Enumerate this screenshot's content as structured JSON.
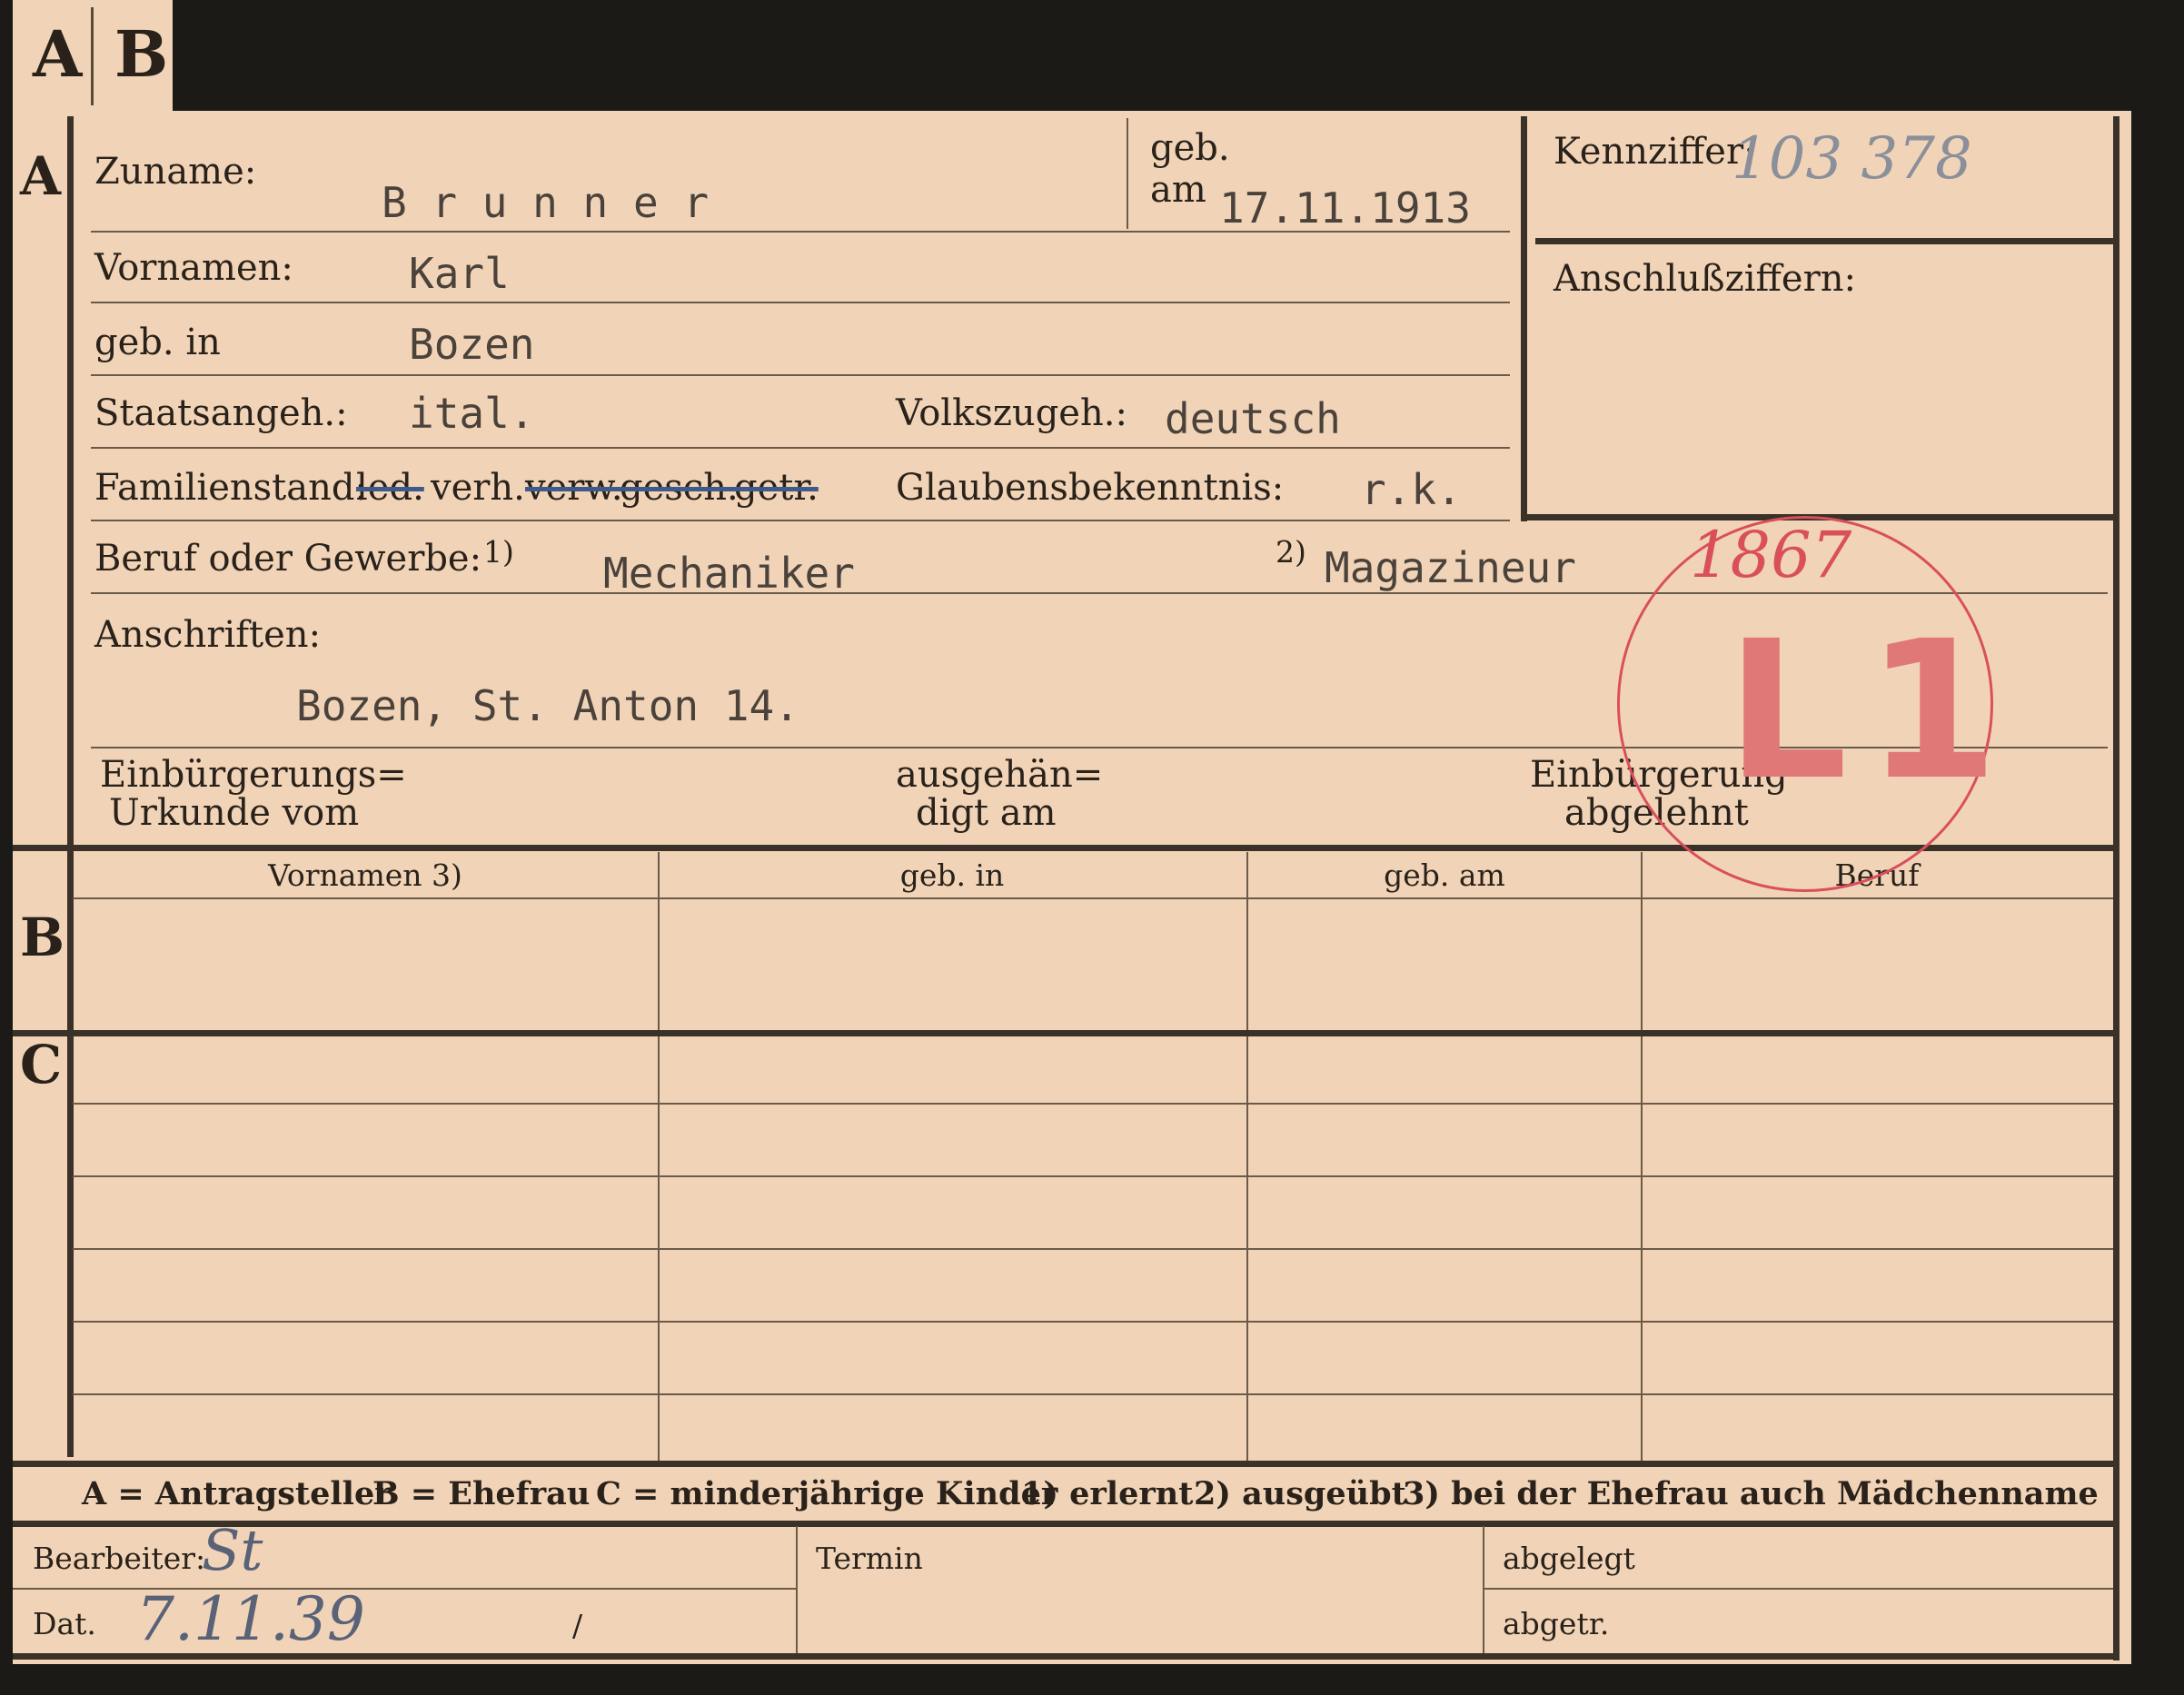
{
  "tabs": {
    "a": "A",
    "b": "B"
  },
  "section_letters": {
    "a": "A",
    "b": "B",
    "c": "C"
  },
  "section_a": {
    "surname_label": "Zuname:",
    "surname_value": "B r u n n e r",
    "born_on_label_1": "geb.",
    "born_on_label_2": "am",
    "born_on_value": "17.11.1913",
    "first_names_label": "Vornamen:",
    "first_names_value": "Karl",
    "born_in_label": "geb. in",
    "born_in_value": "Bozen",
    "citizenship_label": "Staatsangeh.:",
    "citizenship_value": "ital.",
    "ethnicity_label": "Volkszugeh.:",
    "ethnicity_value": "deutsch",
    "marital_label": "Familienstand:",
    "marital_options": [
      "led.",
      "verh.",
      "verw.",
      "gesch.",
      "getr."
    ],
    "religion_label": "Glaubensbekenntnis:",
    "religion_value": "r.k.",
    "occupation_label": "Beruf oder Gewerbe:",
    "occupation_marker_1": "1)",
    "occupation_value_1": "Mechaniker",
    "occupation_marker_2": "2)",
    "occupation_value_2": "Magazineur",
    "addresses_label": "Anschriften:",
    "address_value": "Bozen, St. Anton 14.",
    "naturalization_doc_label_1": "Einbürgerungs=",
    "naturalization_doc_label_2": "Urkunde vom",
    "handed_over_label_1": "ausgehän=",
    "handed_over_label_2": "digt am",
    "naturalization_refused_label_1": "Einbürgerung",
    "naturalization_refused_label_2": "abgelehnt"
  },
  "reference_box": {
    "id_label": "Kennziffer:",
    "id_value": "103 378",
    "connecting_label": "Anschlußziffern:"
  },
  "stamp": {
    "number": "1867",
    "code": "L1",
    "color": "#d9505a"
  },
  "section_b": {
    "columns": [
      "Vornamen 3)",
      "geb. in",
      "geb. am",
      "Beruf"
    ]
  },
  "legend": {
    "a": "A = Antragsteller",
    "b": "B = Ehefrau",
    "c": "C = minderjährige Kinder",
    "n1": "1) erlernt",
    "n2": "2) ausgeübt",
    "n3": "3) bei der Ehefrau auch Mädchenname"
  },
  "footer": {
    "clerk_label": "Bearbeiter:",
    "clerk_value": "St",
    "date_label": "Dat.",
    "date_value": "7.11.39",
    "date_slash": "/",
    "deadline_label": "Termin",
    "filed_label": "abgelegt",
    "sent_label": "abgetr."
  }
}
